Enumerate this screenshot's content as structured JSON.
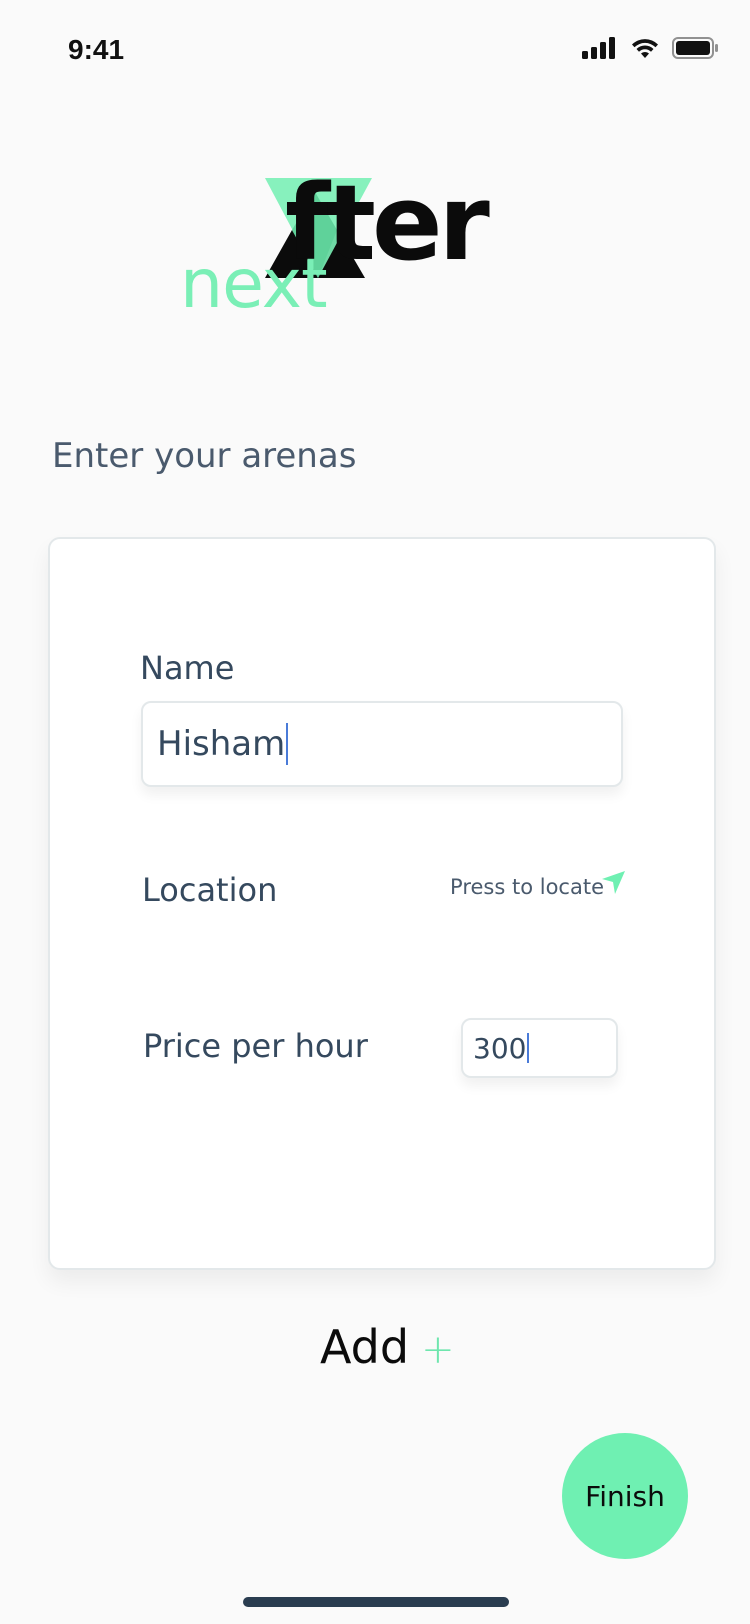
{
  "status_bar": {
    "time": "9:41",
    "signal_icon": "cellular-signal-icon",
    "wifi_icon": "wifi-icon",
    "battery_icon": "battery-icon"
  },
  "logo": {
    "word_main": "fter",
    "word_prefix": "next",
    "accent_color": "#7aefb6"
  },
  "section": {
    "title": "Enter your arenas"
  },
  "form": {
    "name_label": "Name",
    "name_value": "Hisham",
    "location_label": "Location",
    "locate_label": "Press to locate",
    "price_label": "Price per hour",
    "price_value": "300"
  },
  "actions": {
    "add_label": "Add",
    "add_icon": "+",
    "finish_label": "Finish"
  },
  "colors": {
    "accent": "#6ff0b2",
    "text": "#35495e"
  }
}
